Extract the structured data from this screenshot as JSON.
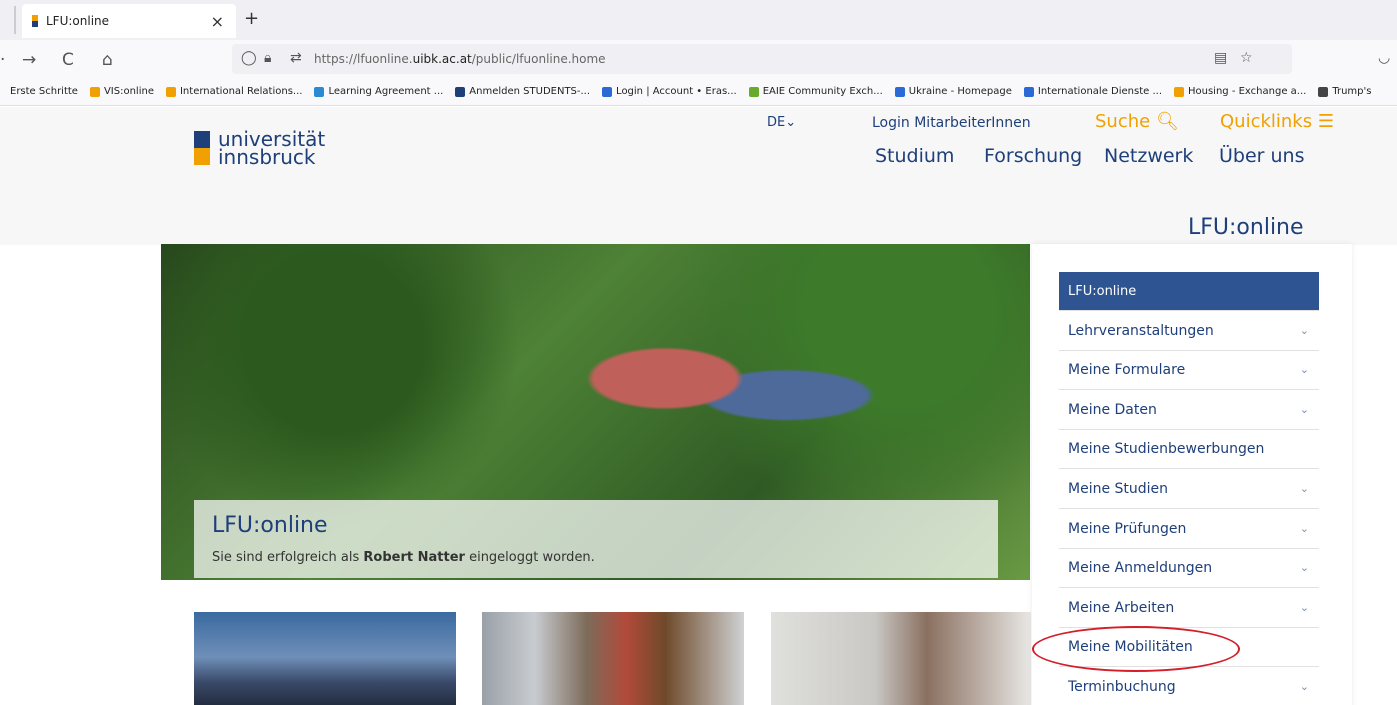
{
  "browser": {
    "tab_title": "LFU:online",
    "tab_close": "×",
    "new_tab": "+",
    "url_prefix": "https://lfuonline.",
    "url_domain": "uibk.ac.at",
    "url_path": "/public/lfuonline.home",
    "bookmarks": [
      {
        "label": "Erste Schritte",
        "color": ""
      },
      {
        "label": "VIS:online",
        "color": "#f0a000"
      },
      {
        "label": "International Relations...",
        "color": "#f0a000"
      },
      {
        "label": "Learning Agreement ...",
        "color": "#2a8ad4"
      },
      {
        "label": "Anmelden STUDENTS-...",
        "color": "#1e3f7a"
      },
      {
        "label": "Login | Account • Eras...",
        "color": "#2a6ad4"
      },
      {
        "label": "EAIE Community Exch...",
        "color": "#6aaa2a"
      },
      {
        "label": "Ukraine - Homepage",
        "color": "#2a6ad4"
      },
      {
        "label": "Internationale Dienste ...",
        "color": "#2a6ad4"
      },
      {
        "label": "Housing - Exchange a...",
        "color": "#f0a000"
      },
      {
        "label": "Trump's",
        "color": "#444444"
      }
    ]
  },
  "header": {
    "logo_line1": "universität",
    "logo_line2": "innsbruck",
    "lang": "DE⌄",
    "login": "Login MitarbeiterInnen",
    "suche": "Suche",
    "quicklinks": "Quicklinks",
    "nav": [
      "Studium",
      "Forschung",
      "Netzwerk",
      "Über uns"
    ],
    "section_title": "LFU:online"
  },
  "hero": {
    "title": "LFU:online",
    "sub_prefix": "Sie sind erfolgreich als ",
    "sub_name": "Robert Natter",
    "sub_suffix": " eingeloggt worden."
  },
  "sidebar": {
    "items": [
      {
        "label": "LFU:online",
        "chevron": false
      },
      {
        "label": "Lehrveranstaltungen",
        "chevron": true
      },
      {
        "label": "Meine Formulare",
        "chevron": true
      },
      {
        "label": "Meine Daten",
        "chevron": true
      },
      {
        "label": "Meine Studienbewerbungen",
        "chevron": false
      },
      {
        "label": "Meine Studien",
        "chevron": true
      },
      {
        "label": "Meine Prüfungen",
        "chevron": true
      },
      {
        "label": "Meine Anmeldungen",
        "chevron": true
      },
      {
        "label": "Meine Arbeiten",
        "chevron": true
      },
      {
        "label": "Meine Mobilitäten",
        "chevron": false
      },
      {
        "label": "Terminbuchung",
        "chevron": true
      }
    ]
  },
  "colors": {
    "brand_blue": "#1e3f7a",
    "brand_orange": "#f0a000",
    "active_item": "#2e5491",
    "highlight_ring": "#d21f2a"
  }
}
